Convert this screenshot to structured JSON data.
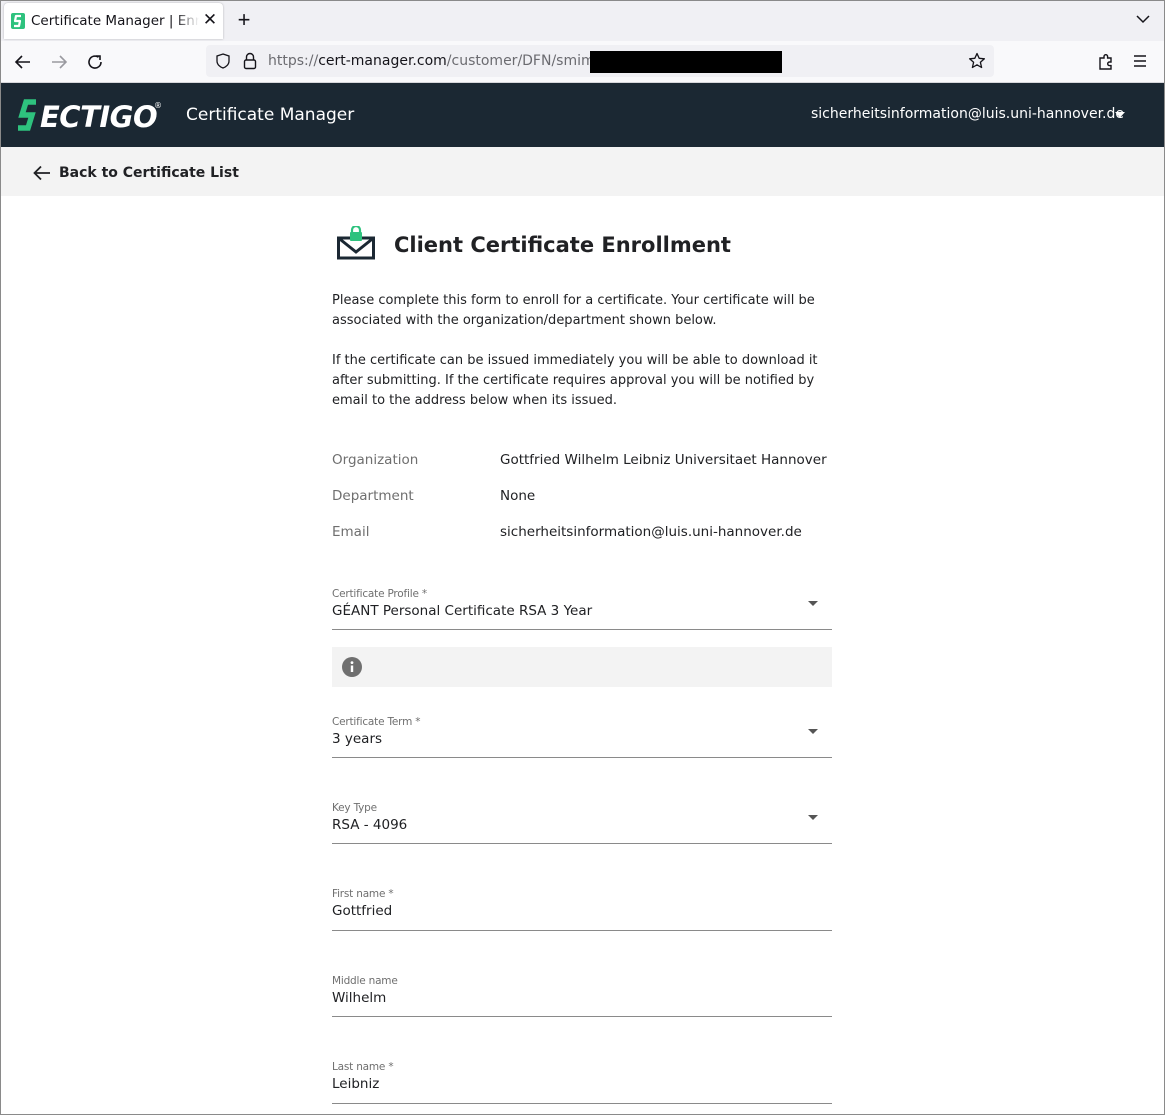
{
  "browser": {
    "tab_title": "Certificate Manager | Enrollment",
    "tab_close": "✕",
    "new_tab": "+",
    "url_prefix": "https://",
    "url_host": "cert-manager.com",
    "url_path": "/customer/DFN/smime/"
  },
  "header": {
    "brand": "SECTIGO",
    "app_name": "Certificate Manager",
    "user_email": "sicherheitsinformation@luis.uni-hannover.de",
    "brand_color": "#2ec27e",
    "background": "#1b2833"
  },
  "backbar": {
    "label": "Back to Certificate List"
  },
  "main": {
    "title": "Client Certificate Enrollment",
    "intro": [
      "Please complete this form to enroll for a certificate. Your certificate will be associated with the organization/department shown below.",
      "If the certificate can be issued immediately you will be able to download it after submitting. If the certificate requires approval you will be notified by email to the address below when its issued."
    ],
    "info": {
      "organization_label": "Organization",
      "organization_value": "Gottfried Wilhelm Leibniz Universitaet Hannover",
      "department_label": "Department",
      "department_value": "None",
      "email_label": "Email",
      "email_value": "sicherheitsinformation@luis.uni-hannover.de"
    },
    "form": {
      "profile_label": "Certificate Profile *",
      "profile_value": "GÉANT Personal Certificate RSA 3 Year",
      "term_label": "Certificate Term *",
      "term_value": "3 years",
      "keytype_label": "Key Type",
      "keytype_value": "RSA - 4096",
      "firstname_label": "First name *",
      "firstname_value": "Gottfried",
      "middlename_label": "Middle name",
      "middlename_value": "Wilhelm",
      "lastname_label": "Last name *",
      "lastname_value": "Leibniz"
    }
  }
}
